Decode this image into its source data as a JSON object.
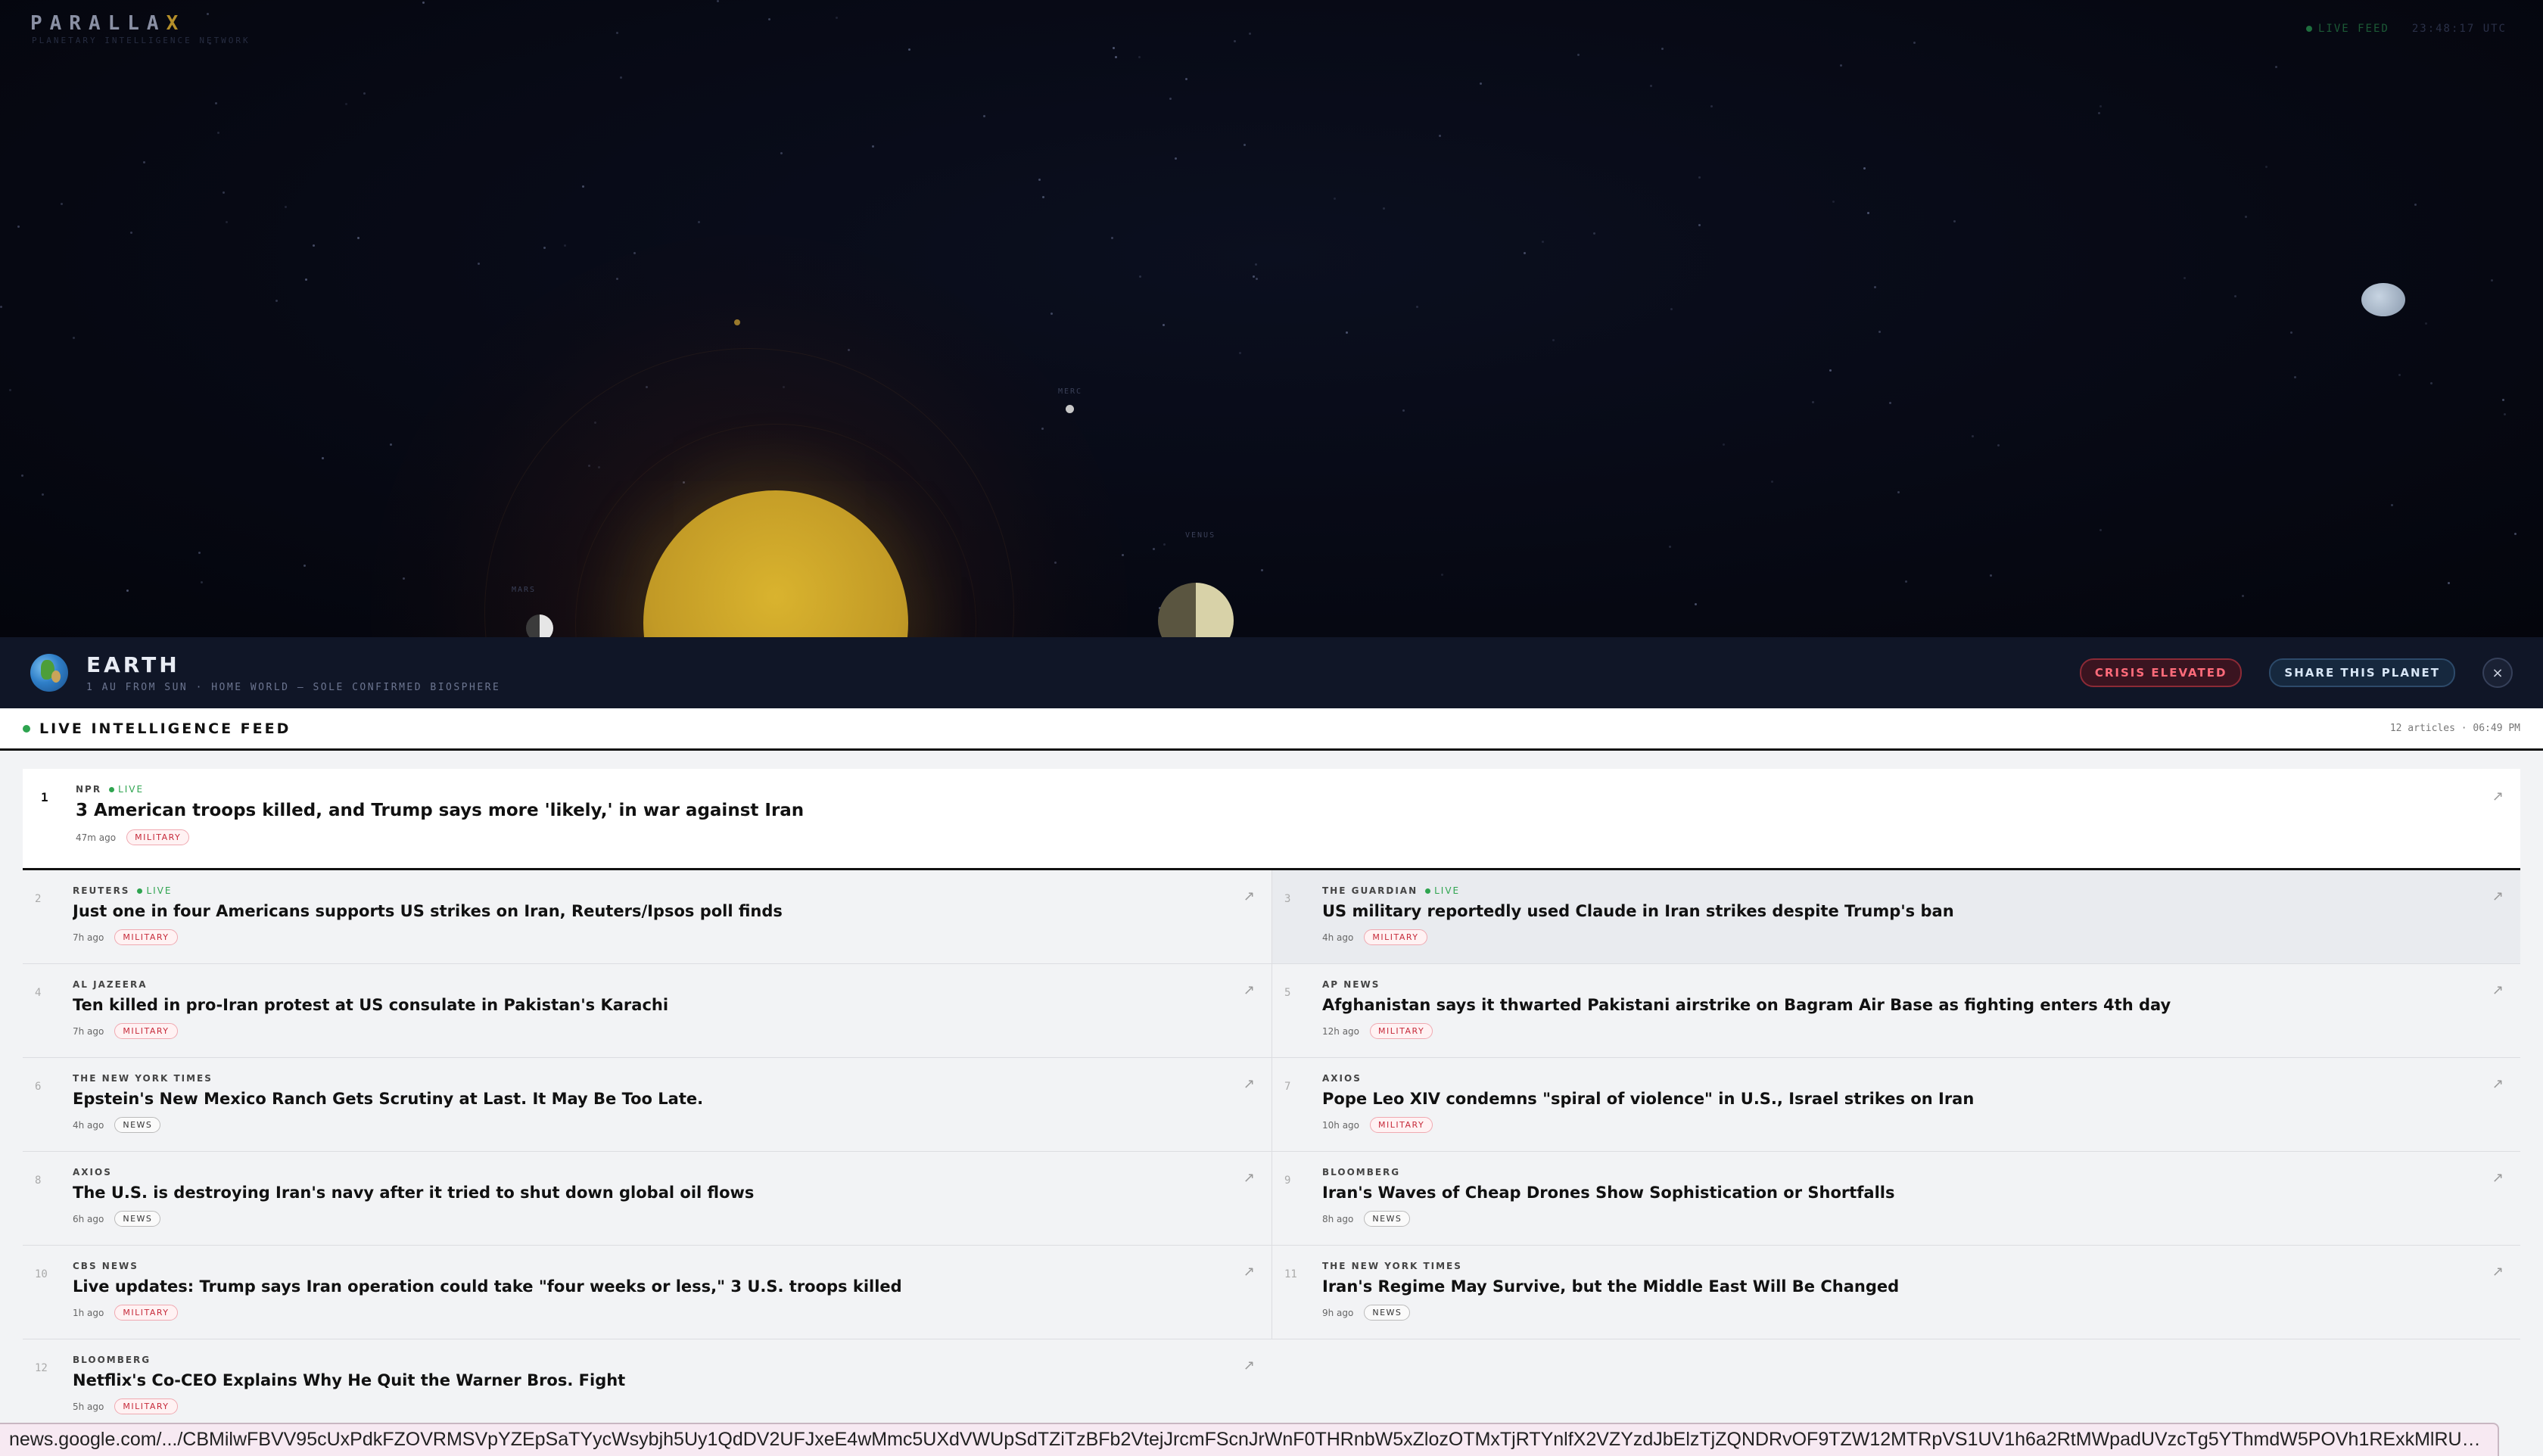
{
  "brand": {
    "name_main": "PARALLA",
    "name_accent": "X",
    "subtitle": "PLANETARY INTELLIGENCE NETWORK"
  },
  "top_right": {
    "live_feed": "LIVE FEED",
    "status": "23:48:17 UTC"
  },
  "planet_labels": {
    "mercury": "MERC",
    "venus": "VENUS",
    "mars": "MARS"
  },
  "planet": {
    "name": "EARTH",
    "subtitle": "1 AU FROM SUN · HOME WORLD — SOLE CONFIRMED BIOSPHERE",
    "crisis_label": "CRISIS ELEVATED",
    "share_label": "SHARE THIS PLANET",
    "close_label": "×"
  },
  "feed": {
    "title": "LIVE INTELLIGENCE FEED",
    "meta": "12 articles · 06:49 PM",
    "lead": {
      "rank": "1",
      "source": "NPR",
      "live": "LIVE",
      "headline": "3 American troops killed, and Trump says more 'likely,' in war against Iran",
      "ago": "47m ago",
      "tag": "MILITARY"
    },
    "items": [
      {
        "rank": "2",
        "source": "REUTERS",
        "live": "LIVE",
        "headline": "Just one in four Americans supports US strikes on Iran, Reuters/Ipsos poll finds",
        "ago": "7h ago",
        "tag": "MILITARY"
      },
      {
        "rank": "3",
        "source": "THE GUARDIAN",
        "live": "LIVE",
        "headline": "US military reportedly used Claude in Iran strikes despite Trump's ban",
        "ago": "4h ago",
        "tag": "MILITARY"
      },
      {
        "rank": "4",
        "source": "AL JAZEERA",
        "live": "",
        "headline": "Ten killed in pro-Iran protest at US consulate in Pakistan's Karachi",
        "ago": "7h ago",
        "tag": "MILITARY"
      },
      {
        "rank": "5",
        "source": "AP NEWS",
        "live": "",
        "headline": "Afghanistan says it thwarted Pakistani airstrike on Bagram Air Base as fighting enters 4th day",
        "ago": "12h ago",
        "tag": "MILITARY"
      },
      {
        "rank": "6",
        "source": "THE NEW YORK TIMES",
        "live": "",
        "headline": "Epstein's New Mexico Ranch Gets Scrutiny at Last. It May Be Too Late.",
        "ago": "4h ago",
        "tag": "NEWS"
      },
      {
        "rank": "7",
        "source": "AXIOS",
        "live": "",
        "headline": "Pope Leo XIV condemns \"spiral of violence\" in U.S., Israel strikes on Iran",
        "ago": "10h ago",
        "tag": "MILITARY"
      },
      {
        "rank": "8",
        "source": "AXIOS",
        "live": "",
        "headline": "The U.S. is destroying Iran's navy after it tried to shut down global oil flows",
        "ago": "6h ago",
        "tag": "NEWS"
      },
      {
        "rank": "9",
        "source": "BLOOMBERG",
        "live": "",
        "headline": "Iran's Waves of Cheap Drones Show Sophistication or Shortfalls",
        "ago": "8h ago",
        "tag": "NEWS"
      },
      {
        "rank": "10",
        "source": "CBS NEWS",
        "live": "",
        "headline": "Live updates: Trump says Iran operation could take \"four weeks or less,\" 3 U.S. troops killed",
        "ago": "1h ago",
        "tag": "MILITARY"
      },
      {
        "rank": "11",
        "source": "THE NEW YORK TIMES",
        "live": "",
        "headline": "Iran's Regime May Survive, but the Middle East Will Be Changed",
        "ago": "9h ago",
        "tag": "NEWS"
      },
      {
        "rank": "12",
        "source": "BLOOMBERG",
        "live": "",
        "headline": "Netflix's Co-CEO Explains Why He Quit the Warner Bros. Fight",
        "ago": "5h ago",
        "tag": "MILITARY"
      }
    ],
    "arrow": "↗"
  },
  "status_url": "news.google.com/.../CBMilwFBVV95cUxPdkFZOVRMSVpYZEpSaTYycWsybjh5Uy1QdDV2UFJxeE4wMmc5UXdVWUpSdTZiTzBFb2VtejJrcmFScnJrWnF0THRnbW5xZlozOTMxTjRTYnlfX2VZYzdJbElzTjZQNDRvOF9TZW12MTRpVS1UV1h6a2RtMWpadUVzcTg5YThmdW5POVh1RExkMlRUb3h5W..."
}
